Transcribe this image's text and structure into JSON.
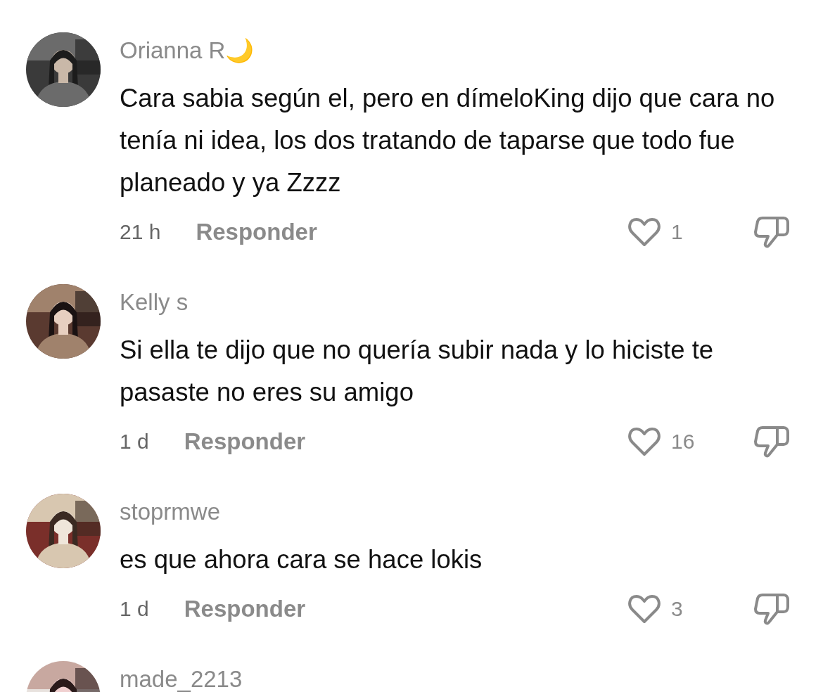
{
  "comments": [
    {
      "author": "Orianna R🌙",
      "text": "Cara sabia según el, pero en dímeloKing dijo que cara no tenía ni idea, los dos tratando de taparse que todo fue planeado y ya Zzzz",
      "time": "21 h",
      "reply": "Responder",
      "likes": "1"
    },
    {
      "author": "Kelly s",
      "text": "Si ella te dijo que no quería subir nada y lo hiciste te pasaste no eres su amigo",
      "time": "1 d",
      "reply": "Responder",
      "likes": "16"
    },
    {
      "author": "stoprmwe",
      "text": "es que ahora cara se hace lokis",
      "time": "1 d",
      "reply": "Responder",
      "likes": "3"
    },
    {
      "author": "made_2213"
    }
  ]
}
